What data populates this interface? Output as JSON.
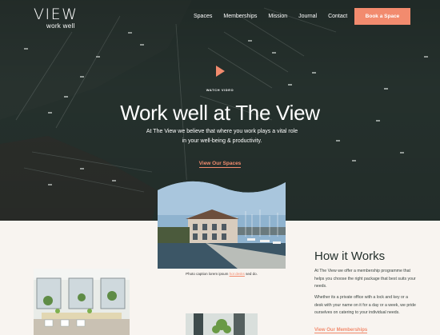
{
  "brand": {
    "logo_main": "VIEW",
    "logo_sub": "work well"
  },
  "nav": {
    "items": [
      "Spaces",
      "Memberships",
      "Mission",
      "Journal",
      "Contact"
    ],
    "cta": "Book a Space"
  },
  "hero": {
    "watch_label": "WATCH VIDEO",
    "title": "Work well at The View",
    "text": "At The View we believe that where you work plays a vital role in your well-being & productivity.",
    "link": "View Our Spaces"
  },
  "photo": {
    "caption_before": "Photo caption lorem ipsum ",
    "caption_link": "hot desks",
    "caption_after": " sed do."
  },
  "how": {
    "title": "How it Works",
    "p1": "At The View we offer a membership programme that helps you choose the right package that best suits your needs.",
    "p2": "Whether its a private office with a lock and key or a desk with your name on it for a day or a week, we pride ourselves on catering to your individual needs.",
    "link": "View Our Memberships"
  },
  "colors": {
    "accent": "#f28b6e",
    "hero_bg": "#24302d",
    "page_bg": "#f8f4f0"
  },
  "icons": {
    "play": "play-icon"
  }
}
